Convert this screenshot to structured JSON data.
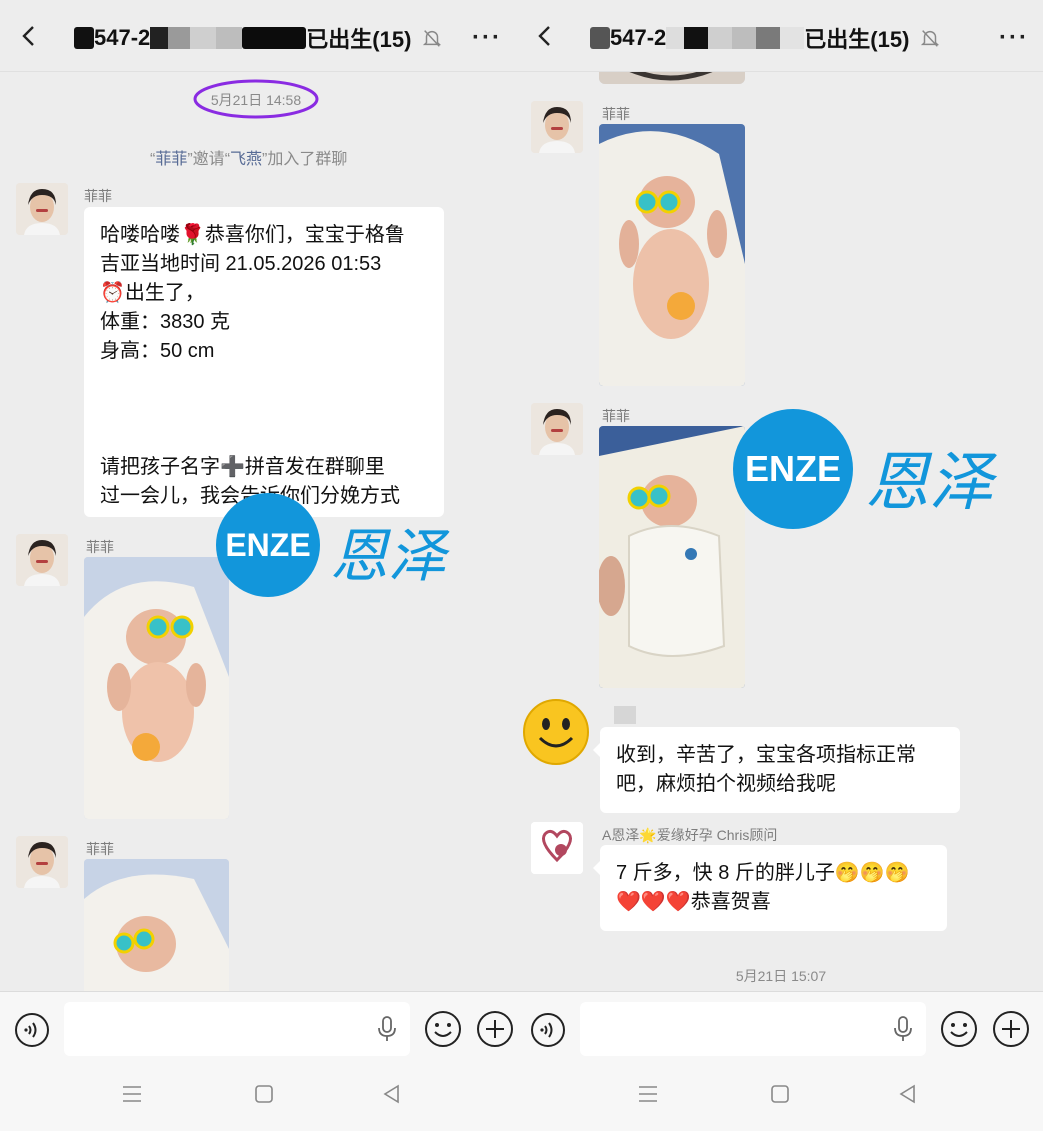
{
  "left": {
    "header": {
      "title_prefix": "547-2",
      "title_suffix": "已出生(15)",
      "more": "···"
    },
    "timestamp": "5月21日 14:58",
    "system_message": {
      "inviter": "菲菲",
      "text1": "邀请",
      "invitee": "飞燕",
      "text2": "加入了群聊"
    },
    "messages": [
      {
        "sender": "菲菲",
        "lines": [
          "哈喽哈喽🌹恭喜你们，宝宝于格鲁",
          "吉亚当地时间 21.05.2026 01:53",
          "⏰出生了，",
          "体重：3830 克",
          "身高：50 cm",
          "",
          "",
          "",
          "请把孩子名字➕拼音发在群聊里",
          "过一会儿，我会告诉你们分娩方式"
        ]
      },
      {
        "sender": "菲菲",
        "type": "image"
      },
      {
        "sender": "菲菲",
        "type": "image"
      }
    ],
    "watermark": {
      "latin": "ENZE",
      "chinese": "恩泽"
    }
  },
  "right": {
    "header": {
      "title_prefix": "547-2",
      "title_suffix": "已出生(15)",
      "more": "···"
    },
    "messages": [
      {
        "sender": "菲菲",
        "type": "image"
      },
      {
        "sender": "菲菲",
        "type": "image"
      },
      {
        "sender": "",
        "text_lines": [
          "收到，辛苦了，宝宝各项指标正常",
          "吧，麻烦拍个视频给我呢"
        ]
      },
      {
        "sender": "A恩泽🌟爱缘好孕 Chris顾问",
        "text_lines": [
          "7 斤多，快 8 斤的胖儿子🤭🤭🤭",
          "❤️❤️❤️恭喜贺喜"
        ]
      }
    ],
    "timestamp": "5月21日 15:07",
    "watermark": {
      "latin": "ENZE",
      "chinese": "恩泽"
    }
  },
  "icons": {
    "back": "chevron-left-icon",
    "mute": "bell-off-icon",
    "voice": "voice-icon",
    "mic": "microphone-icon",
    "emoji": "smiley-icon",
    "plus": "plus-icon",
    "nav_menu": "menu-icon",
    "nav_home": "square-icon",
    "nav_back": "triangle-left-icon"
  },
  "colors": {
    "chat_bg": "#ededed",
    "bubble": "#ffffff",
    "link": "#576b95",
    "watermark": "#1296db",
    "highlight_circle": "#8a2be2"
  }
}
